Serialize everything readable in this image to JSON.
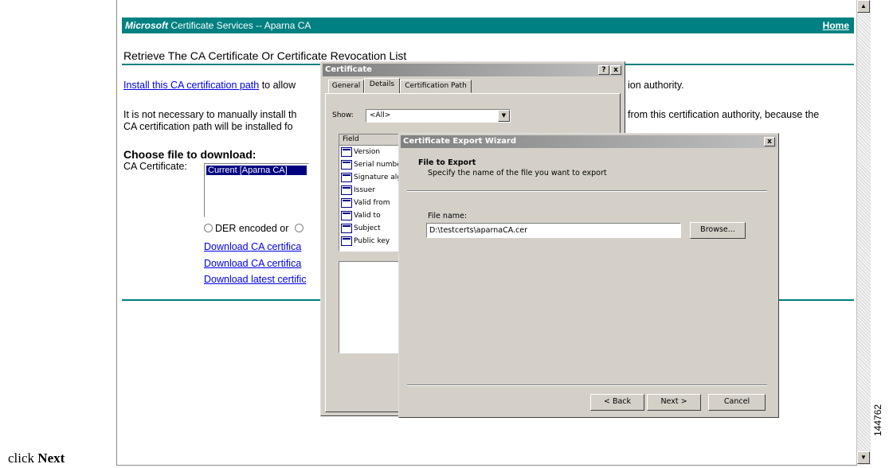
{
  "browser": {
    "header": {
      "brand": "Microsoft",
      "title": " Certificate Services  --  Aparna CA",
      "home": "Home"
    },
    "page": {
      "heading": "Retrieve The CA Certificate Or Certificate Revocation List",
      "install_link": "Install this CA certification path",
      "install_text": " to allow",
      "install_tail": "ion authority.",
      "para1": "It is not necessary to manually install th",
      "para1_tail": "from this certification authority, because the",
      "para2": "CA certification path will be installed fo",
      "choose_heading": "Choose file to download:",
      "ca_cert_label": "CA Certificate:",
      "ca_cert_selected": "Current [Aparna CA]",
      "encoding_text": "DER encoded  or",
      "downloads": [
        "Download CA certifica",
        "Download CA certifica",
        "Download latest certific"
      ]
    }
  },
  "cert_dialog": {
    "title": "Certificate",
    "help_btn": "?",
    "close_btn": "x",
    "tabs": [
      "General",
      "Details",
      "Certification Path"
    ],
    "show_label": "Show:",
    "show_value": "<All>",
    "field_header": "Field",
    "fields": [
      "Version",
      "Serial numbe",
      "Signature alg",
      "Issuer",
      "Valid from",
      "Valid to",
      "Subject",
      "Public key"
    ]
  },
  "wizard": {
    "title": "Certificate Export Wizard",
    "close_btn": "x",
    "section_title": "File to Export",
    "section_desc": "Specify the name of the file you want to export",
    "file_label": "File name:",
    "file_value": "D:\\testcerts\\aparnaCA.cer",
    "browse": "Browse...",
    "back": "< Back",
    "next": "Next >",
    "cancel": "Cancel"
  },
  "caption": {
    "prefix": "click ",
    "bold": "Next"
  },
  "figure_id": "144762"
}
